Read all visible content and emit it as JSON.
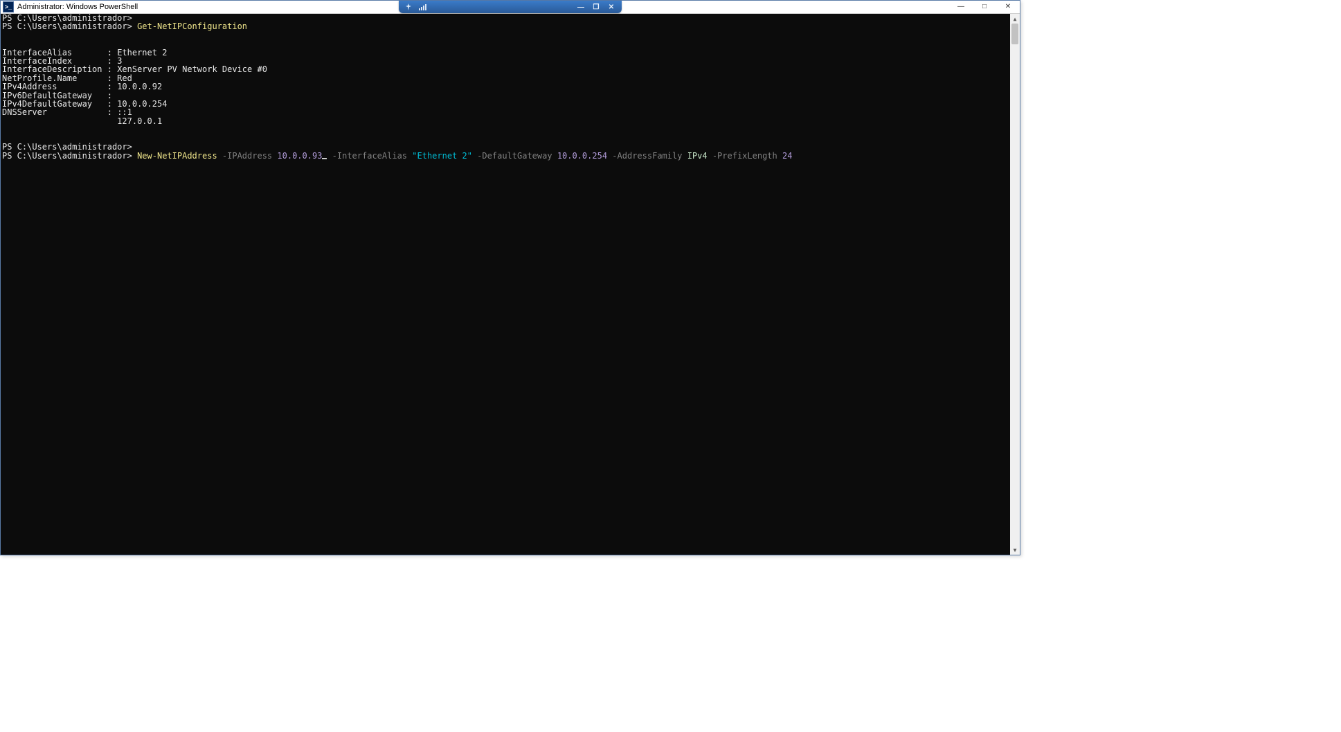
{
  "window": {
    "title_prefix": "Administrator:",
    "title_app": "Windows PowerShell",
    "ps_icon_glyph": ">_"
  },
  "rdp": {
    "pin_icon": "push-pin",
    "signal_icon": "signal-bars",
    "min_glyph": "—",
    "restore_glyph": "❐",
    "close_glyph": "✕"
  },
  "outer_controls": {
    "minimize_glyph": "—",
    "maximize_glyph": "□",
    "close_glyph": "✕"
  },
  "terminal": {
    "prompt1": "PS C:\\Users\\administrador>",
    "prompt2": "PS C:\\Users\\administrador> ",
    "cmd_get": "Get-NetIPConfiguration",
    "output": {
      "blank": "",
      "labels": {
        "ifalias": "InterfaceAlias",
        "ifindex": "InterfaceIndex",
        "ifdesc": "InterfaceDescription",
        "netprof": "NetProfile.Name",
        "ipv4": "IPv4Address",
        "ipv6gw": "IPv6DefaultGateway",
        "ipv4gw": "IPv4DefaultGateway",
        "dns": "DNSServer"
      },
      "values": {
        "ifalias": "Ethernet 2",
        "ifindex": "3",
        "ifdesc": "XenServer PV Network Device #0",
        "netprof": "Red",
        "ipv4": "10.0.0.92",
        "ipv6gw": "",
        "ipv4gw": "10.0.0.254",
        "dns1": "::1",
        "dns2": "127.0.0.1"
      }
    },
    "second_cmd": {
      "cmdlet": "New-NetIPAddress",
      "p_ip": "-IPAddress",
      "v_ip": "10.0.0.93",
      "p_alias": "-InterfaceAlias",
      "v_alias": "\"Ethernet 2\"",
      "p_gw": "-DefaultGateway",
      "v_gw": "10.0.0.254",
      "p_af": "-AddressFamily",
      "v_af": "IPv4",
      "p_pl": "-PrefixLength",
      "v_pl": "24"
    }
  },
  "scrollbar": {
    "arrow_up": "▲",
    "arrow_down": "▼"
  }
}
